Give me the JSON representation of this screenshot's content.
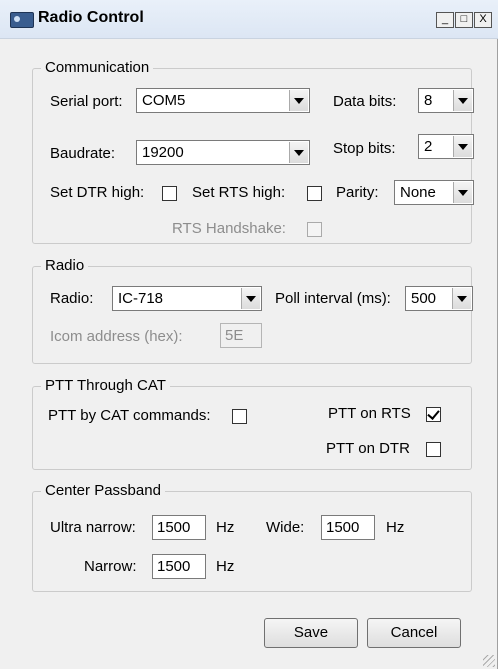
{
  "window": {
    "title": "Radio Control",
    "controls": {
      "minimize": "_",
      "maximize": "□",
      "close": "X"
    }
  },
  "communication": {
    "legend": "Communication",
    "serial_port_label": "Serial port:",
    "serial_port_value": "COM5",
    "data_bits_label": "Data bits:",
    "data_bits_value": "8",
    "baudrate_label": "Baudrate:",
    "baudrate_value": "19200",
    "stop_bits_label": "Stop bits:",
    "stop_bits_value": "2",
    "set_dtr_label": "Set DTR high:",
    "set_dtr_checked": false,
    "set_rts_label": "Set RTS high:",
    "set_rts_checked": false,
    "parity_label": "Parity:",
    "parity_value": "None",
    "rts_handshake_label": "RTS Handshake:",
    "rts_handshake_checked": false
  },
  "radio": {
    "legend": "Radio",
    "radio_label": "Radio:",
    "radio_value": "IC-718",
    "poll_label": "Poll interval (ms):",
    "poll_value": "500",
    "icom_label": "Icom address (hex):",
    "icom_value": "5E"
  },
  "ptt": {
    "legend": "PTT Through CAT",
    "cat_label": "PTT by CAT commands:",
    "cat_checked": false,
    "rts_label": "PTT on RTS",
    "rts_checked": true,
    "dtr_label": "PTT on DTR",
    "dtr_checked": false
  },
  "passband": {
    "legend": "Center Passband",
    "ultra_label": "Ultra narrow:",
    "ultra_value": "1500",
    "ultra_unit": "Hz",
    "wide_label": "Wide:",
    "wide_value": "1500",
    "wide_unit": "Hz",
    "narrow_label": "Narrow:",
    "narrow_value": "1500",
    "narrow_unit": "Hz"
  },
  "buttons": {
    "save": "Save",
    "cancel": "Cancel"
  }
}
